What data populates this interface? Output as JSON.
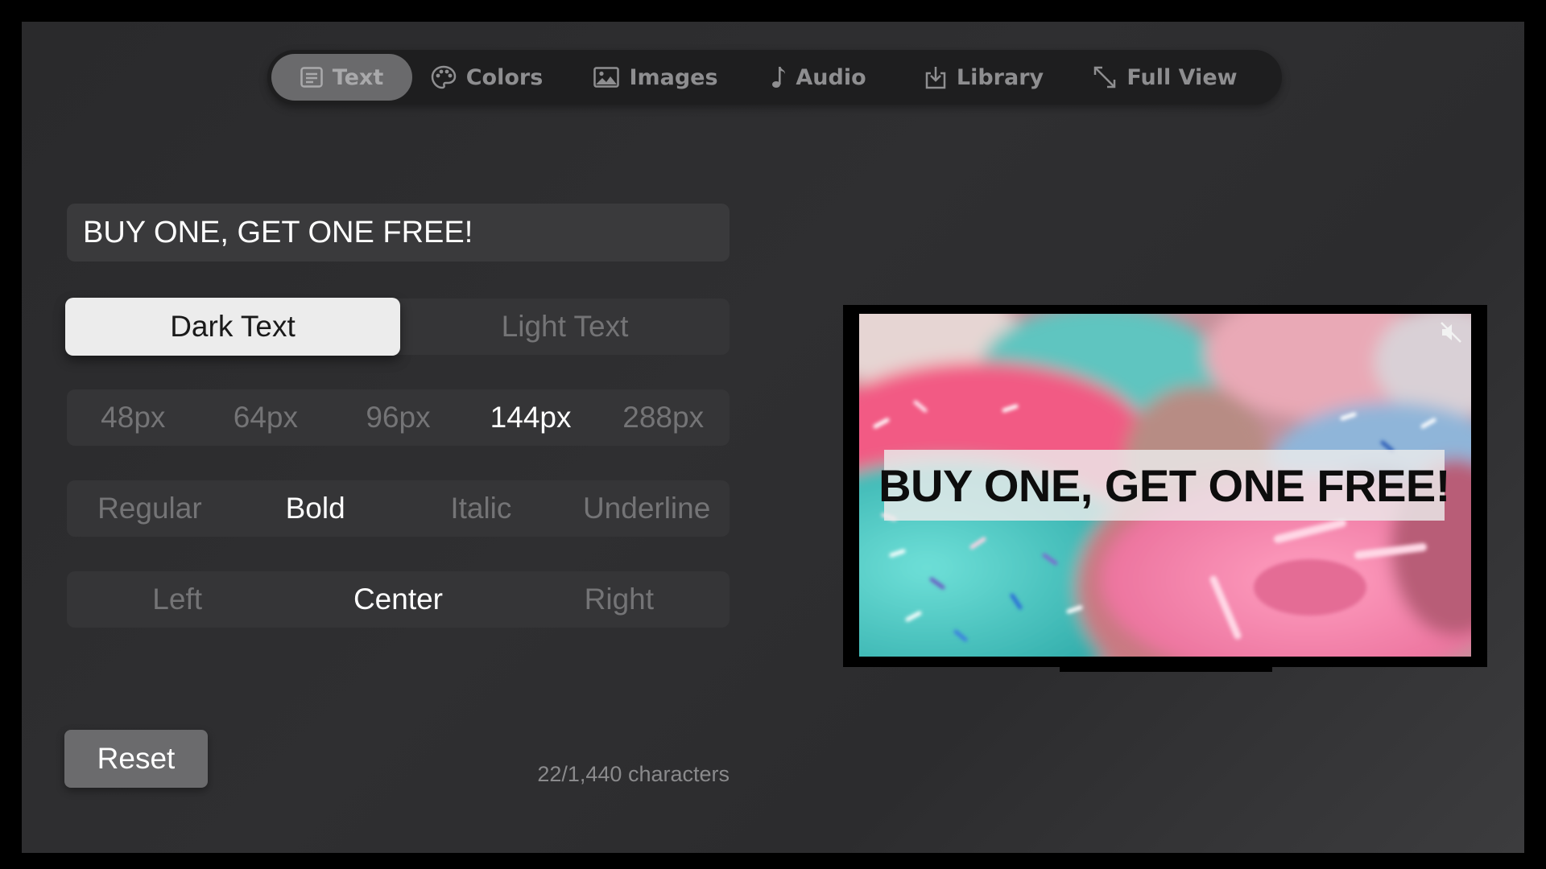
{
  "tabs": [
    {
      "label": "Text",
      "icon": "text-document-icon",
      "selected": true
    },
    {
      "label": "Colors",
      "icon": "palette-icon",
      "selected": false
    },
    {
      "label": "Images",
      "icon": "image-icon",
      "selected": false
    },
    {
      "label": "Audio",
      "icon": "music-note-icon",
      "selected": false
    },
    {
      "label": "Library",
      "icon": "library-download-icon",
      "selected": false
    },
    {
      "label": "Full View",
      "icon": "expand-arrows-icon",
      "selected": false
    }
  ],
  "editor": {
    "text_value": "BUY ONE, GET ONE FREE!",
    "theme_options": [
      "Dark Text",
      "Light Text"
    ],
    "theme_selected": "Dark Text",
    "size_options": [
      "48px",
      "64px",
      "96px",
      "144px",
      "288px"
    ],
    "size_selected": "144px",
    "style_options": [
      "Regular",
      "Bold",
      "Italic",
      "Underline"
    ],
    "style_selected": "Bold",
    "align_options": [
      "Left",
      "Center",
      "Right"
    ],
    "align_selected": "Center",
    "reset_label": "Reset",
    "char_count": "22/1,440 characters"
  },
  "preview": {
    "banner_text": "BUY ONE, GET ONE FREE!",
    "mute_icon": "speaker-muted-icon",
    "background_image": "colorful frosted donuts with sprinkles"
  },
  "colors": {
    "background": "#2e2e30",
    "tabbar": "#1e1e1f",
    "selected_tab": "#6a6a6c",
    "segment_bg": "#353537",
    "active_segment": "#ececec",
    "reset_button": "#6b6b6d"
  }
}
